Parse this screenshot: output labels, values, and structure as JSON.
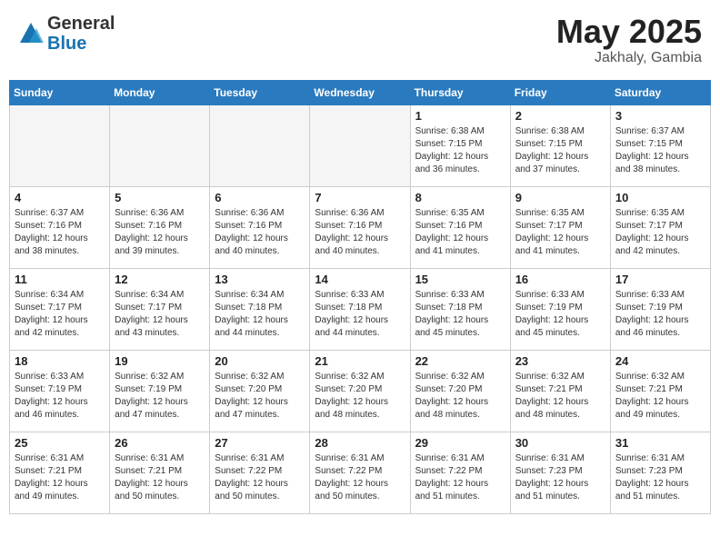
{
  "header": {
    "logo_general": "General",
    "logo_blue": "Blue",
    "month": "May 2025",
    "location": "Jakhaly, Gambia"
  },
  "days_of_week": [
    "Sunday",
    "Monday",
    "Tuesday",
    "Wednesday",
    "Thursday",
    "Friday",
    "Saturday"
  ],
  "weeks": [
    [
      {
        "day": "",
        "info": ""
      },
      {
        "day": "",
        "info": ""
      },
      {
        "day": "",
        "info": ""
      },
      {
        "day": "",
        "info": ""
      },
      {
        "day": "1",
        "info": "Sunrise: 6:38 AM\nSunset: 7:15 PM\nDaylight: 12 hours\nand 36 minutes."
      },
      {
        "day": "2",
        "info": "Sunrise: 6:38 AM\nSunset: 7:15 PM\nDaylight: 12 hours\nand 37 minutes."
      },
      {
        "day": "3",
        "info": "Sunrise: 6:37 AM\nSunset: 7:15 PM\nDaylight: 12 hours\nand 38 minutes."
      }
    ],
    [
      {
        "day": "4",
        "info": "Sunrise: 6:37 AM\nSunset: 7:16 PM\nDaylight: 12 hours\nand 38 minutes."
      },
      {
        "day": "5",
        "info": "Sunrise: 6:36 AM\nSunset: 7:16 PM\nDaylight: 12 hours\nand 39 minutes."
      },
      {
        "day": "6",
        "info": "Sunrise: 6:36 AM\nSunset: 7:16 PM\nDaylight: 12 hours\nand 40 minutes."
      },
      {
        "day": "7",
        "info": "Sunrise: 6:36 AM\nSunset: 7:16 PM\nDaylight: 12 hours\nand 40 minutes."
      },
      {
        "day": "8",
        "info": "Sunrise: 6:35 AM\nSunset: 7:16 PM\nDaylight: 12 hours\nand 41 minutes."
      },
      {
        "day": "9",
        "info": "Sunrise: 6:35 AM\nSunset: 7:17 PM\nDaylight: 12 hours\nand 41 minutes."
      },
      {
        "day": "10",
        "info": "Sunrise: 6:35 AM\nSunset: 7:17 PM\nDaylight: 12 hours\nand 42 minutes."
      }
    ],
    [
      {
        "day": "11",
        "info": "Sunrise: 6:34 AM\nSunset: 7:17 PM\nDaylight: 12 hours\nand 42 minutes."
      },
      {
        "day": "12",
        "info": "Sunrise: 6:34 AM\nSunset: 7:17 PM\nDaylight: 12 hours\nand 43 minutes."
      },
      {
        "day": "13",
        "info": "Sunrise: 6:34 AM\nSunset: 7:18 PM\nDaylight: 12 hours\nand 44 minutes."
      },
      {
        "day": "14",
        "info": "Sunrise: 6:33 AM\nSunset: 7:18 PM\nDaylight: 12 hours\nand 44 minutes."
      },
      {
        "day": "15",
        "info": "Sunrise: 6:33 AM\nSunset: 7:18 PM\nDaylight: 12 hours\nand 45 minutes."
      },
      {
        "day": "16",
        "info": "Sunrise: 6:33 AM\nSunset: 7:19 PM\nDaylight: 12 hours\nand 45 minutes."
      },
      {
        "day": "17",
        "info": "Sunrise: 6:33 AM\nSunset: 7:19 PM\nDaylight: 12 hours\nand 46 minutes."
      }
    ],
    [
      {
        "day": "18",
        "info": "Sunrise: 6:33 AM\nSunset: 7:19 PM\nDaylight: 12 hours\nand 46 minutes."
      },
      {
        "day": "19",
        "info": "Sunrise: 6:32 AM\nSunset: 7:19 PM\nDaylight: 12 hours\nand 47 minutes."
      },
      {
        "day": "20",
        "info": "Sunrise: 6:32 AM\nSunset: 7:20 PM\nDaylight: 12 hours\nand 47 minutes."
      },
      {
        "day": "21",
        "info": "Sunrise: 6:32 AM\nSunset: 7:20 PM\nDaylight: 12 hours\nand 48 minutes."
      },
      {
        "day": "22",
        "info": "Sunrise: 6:32 AM\nSunset: 7:20 PM\nDaylight: 12 hours\nand 48 minutes."
      },
      {
        "day": "23",
        "info": "Sunrise: 6:32 AM\nSunset: 7:21 PM\nDaylight: 12 hours\nand 48 minutes."
      },
      {
        "day": "24",
        "info": "Sunrise: 6:32 AM\nSunset: 7:21 PM\nDaylight: 12 hours\nand 49 minutes."
      }
    ],
    [
      {
        "day": "25",
        "info": "Sunrise: 6:31 AM\nSunset: 7:21 PM\nDaylight: 12 hours\nand 49 minutes."
      },
      {
        "day": "26",
        "info": "Sunrise: 6:31 AM\nSunset: 7:21 PM\nDaylight: 12 hours\nand 50 minutes."
      },
      {
        "day": "27",
        "info": "Sunrise: 6:31 AM\nSunset: 7:22 PM\nDaylight: 12 hours\nand 50 minutes."
      },
      {
        "day": "28",
        "info": "Sunrise: 6:31 AM\nSunset: 7:22 PM\nDaylight: 12 hours\nand 50 minutes."
      },
      {
        "day": "29",
        "info": "Sunrise: 6:31 AM\nSunset: 7:22 PM\nDaylight: 12 hours\nand 51 minutes."
      },
      {
        "day": "30",
        "info": "Sunrise: 6:31 AM\nSunset: 7:23 PM\nDaylight: 12 hours\nand 51 minutes."
      },
      {
        "day": "31",
        "info": "Sunrise: 6:31 AM\nSunset: 7:23 PM\nDaylight: 12 hours\nand 51 minutes."
      }
    ]
  ]
}
